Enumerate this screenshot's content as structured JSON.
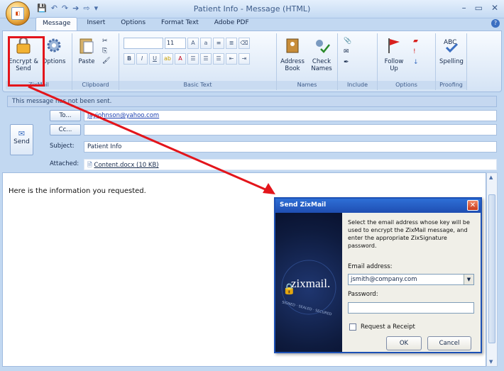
{
  "window": {
    "title": "Patient Info - Message (HTML)",
    "orb_label": "Office",
    "min": "–",
    "max": "▭",
    "close": "✕",
    "help": "?"
  },
  "tabs": [
    "Message",
    "Insert",
    "Options",
    "Format Text",
    "Adobe PDF"
  ],
  "ribbon": {
    "zixmail": {
      "encrypt": "Encrypt & Send",
      "options": "Options",
      "group": "ZixMail"
    },
    "clipboard": {
      "paste": "Paste",
      "group": "Clipboard"
    },
    "basic_text": {
      "font_size": "11",
      "group": "Basic Text"
    },
    "names": {
      "address_book": "Address Book",
      "check_names": "Check Names",
      "group": "Names"
    },
    "include": {
      "group": "Include"
    },
    "options": {
      "follow_up": "Follow Up",
      "group": "Options"
    },
    "proofing": {
      "spelling": "Spelling",
      "group": "Proofing"
    }
  },
  "infobar": "This message has not been sent.",
  "header": {
    "send": "Send",
    "to_button": "To...",
    "to_value": "jayjohnson@yahoo.com",
    "cc_button": "Cc...",
    "cc_value": "",
    "subject_label": "Subject:",
    "subject_value": "Patient Info",
    "attached_label": "Attached:",
    "attached_value": "Content.docx (10 KB)"
  },
  "body_text": "Here is the information you requested.",
  "dialog": {
    "title": "Send ZixMail",
    "brand": "zixmail.",
    "tagline": "SIGNED · SEALED · SECURED",
    "instructions": "Select the email address whose key will be used to encrypt the ZixMail message, and enter the appropriate ZixSignature password.",
    "email_label": "Email address:",
    "email_value": "jsmith@company.com",
    "password_label": "Password:",
    "password_value": "",
    "receipt_label": "Request a Receipt",
    "ok": "OK",
    "cancel": "Cancel"
  },
  "colors": {
    "accent": "#1c50b5",
    "highlight": "#e3151b",
    "ribbon": "#d4e3f5"
  }
}
